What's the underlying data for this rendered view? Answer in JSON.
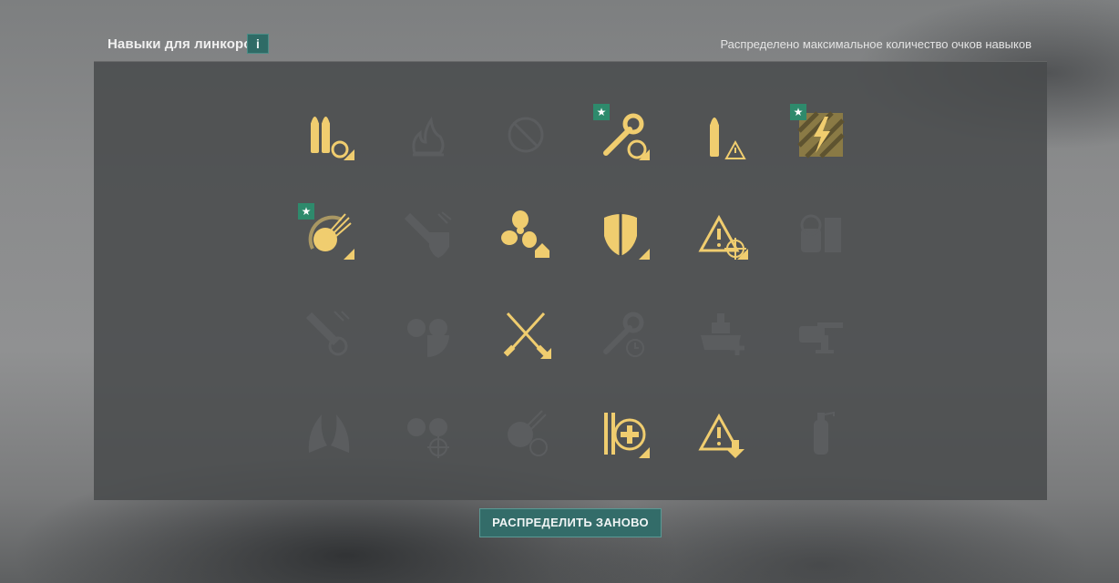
{
  "header": {
    "title": "Навыки для линкоров",
    "info_label": "i",
    "status": "Распределено максимальное количество очков навыков"
  },
  "colors": {
    "active_icon": "#f0cd6f",
    "inactive_icon": "#5b5d5f",
    "accent": "#336c69",
    "star_badge": "#2e8a6c"
  },
  "skills": [
    {
      "icon": "shells-reload-icon",
      "active": true,
      "starred": false
    },
    {
      "icon": "fire-icon",
      "active": false,
      "starred": false
    },
    {
      "icon": "prohibited-icon",
      "active": false,
      "starred": false
    },
    {
      "icon": "wrench-reload-icon",
      "active": true,
      "starred": true
    },
    {
      "icon": "shell-warning-icon",
      "active": true,
      "starred": false
    },
    {
      "icon": "lightning-hazard-icon",
      "active": true,
      "starred": true
    },
    {
      "icon": "aa-burst-icon",
      "active": true,
      "starred": true
    },
    {
      "icon": "torpedo-shield-icon",
      "active": false,
      "starred": false
    },
    {
      "icon": "propeller-upgrade-icon",
      "active": true,
      "starred": false
    },
    {
      "icon": "shield-binoculars-icon",
      "active": true,
      "starred": false
    },
    {
      "icon": "warning-crosshair-icon",
      "active": true,
      "starred": false
    },
    {
      "icon": "aa-turret-icon",
      "active": false,
      "starred": false
    },
    {
      "icon": "torpedo-reload-icon",
      "active": false,
      "starred": false
    },
    {
      "icon": "aa-guns-sector-icon",
      "active": false,
      "starred": false
    },
    {
      "icon": "crossed-tools-icon",
      "active": true,
      "starred": false
    },
    {
      "icon": "wrench-timer-icon",
      "active": false,
      "starred": false
    },
    {
      "icon": "battleship-repair-icon",
      "active": false,
      "starred": false
    },
    {
      "icon": "secondary-guns-icon",
      "active": false,
      "starred": false
    },
    {
      "icon": "dual-flames-icon",
      "active": false,
      "starred": false
    },
    {
      "icon": "aa-guns-crosshair-icon",
      "active": false,
      "starred": false
    },
    {
      "icon": "aa-timer-icon",
      "active": false,
      "starred": false
    },
    {
      "icon": "tools-heal-icon",
      "active": true,
      "starred": false
    },
    {
      "icon": "warning-down-icon",
      "active": true,
      "starred": false
    },
    {
      "icon": "extinguisher-icon",
      "active": false,
      "starred": false
    }
  ],
  "footer": {
    "reset_label": "РАСПРЕДЕЛИТЬ ЗАНОВО"
  }
}
